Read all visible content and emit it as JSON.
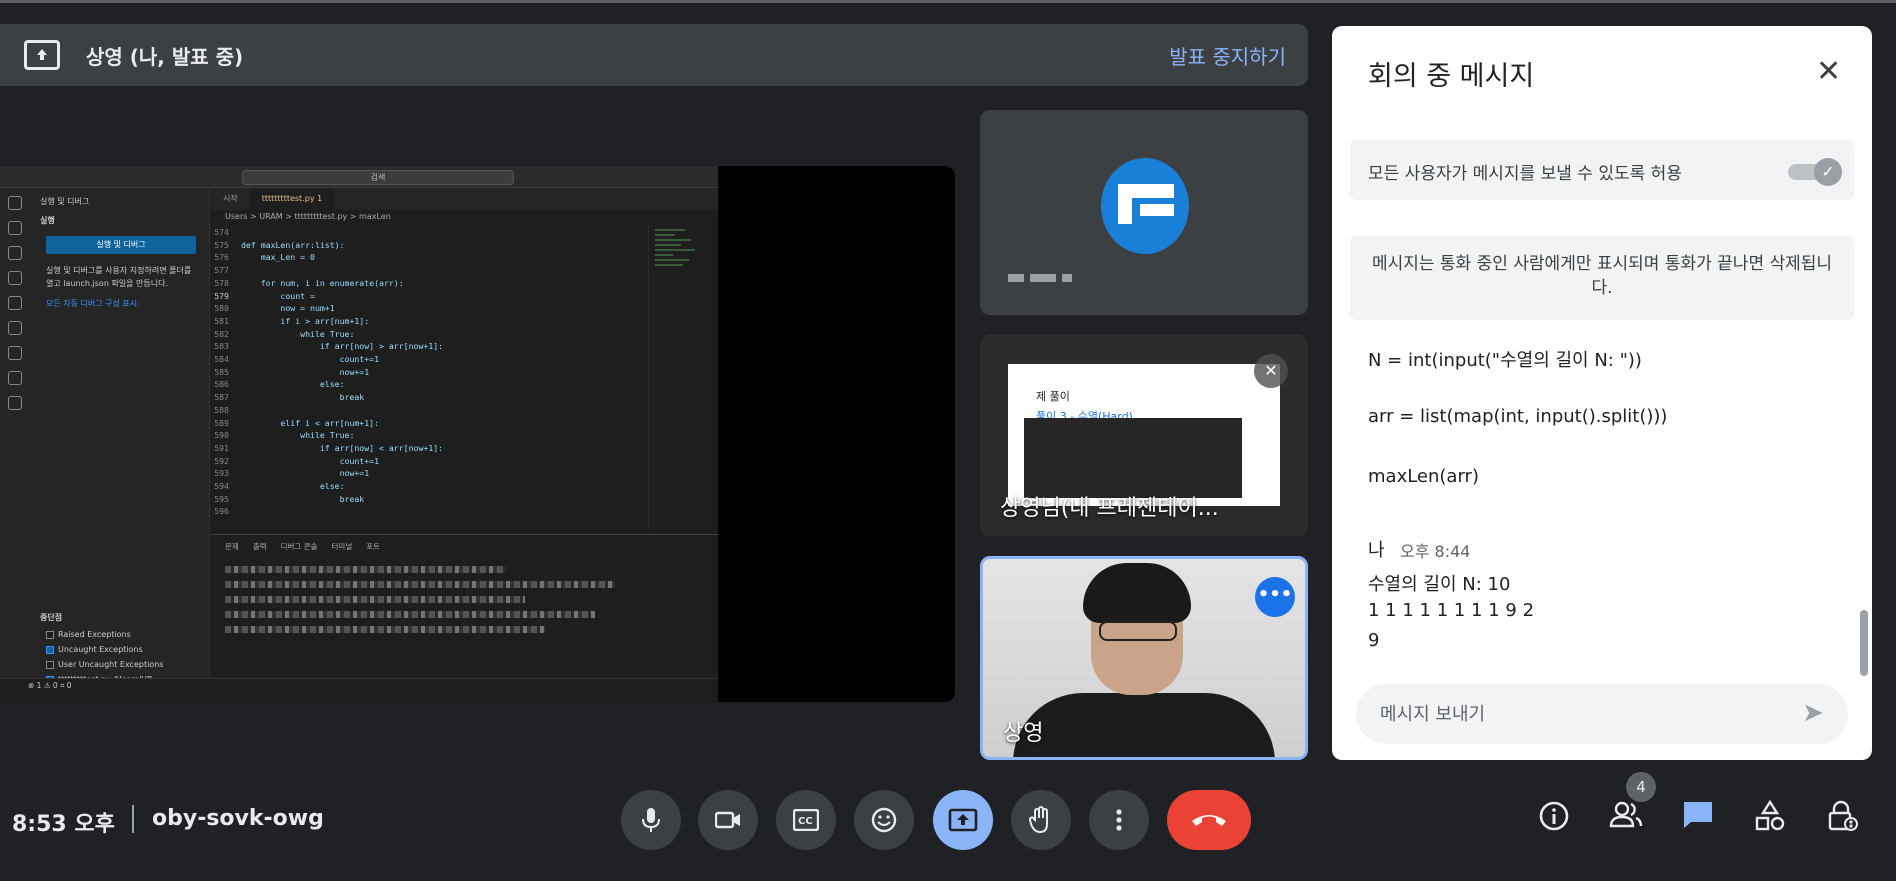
{
  "present_bar": {
    "title": "상영 (나, 발표 중)",
    "stop_label": "발표 중지하기"
  },
  "vscode": {
    "search": "검색",
    "sidebar_header": "실행 및 디버그",
    "sidebar_section": "실행",
    "run_button": "실행 및 디버그",
    "help_text": "실행 및 디버그를 사용자 지정하려면 폴더를 열고 launch.json 파일을 만듭니다.",
    "show_all_link": "모든 자동 디버그 구성 표시.",
    "breakpoints_header": "중단점",
    "breakpoints": [
      {
        "label": "Raised Exceptions",
        "checked": false
      },
      {
        "label": "Uncaught Exceptions",
        "checked": true
      },
      {
        "label": "User Uncaught Exceptions",
        "checked": false
      },
      {
        "label": "tttttttttest.py  /Users/UR...",
        "checked": true
      }
    ],
    "tabs": [
      "시작",
      "tttttttttest.py 1"
    ],
    "breadcrumb": "Users > URAM > tttttttttest.py > maxLen",
    "code": [
      {
        "ln": "574",
        "text": ""
      },
      {
        "ln": "575",
        "text": "def maxLen(arr:list):"
      },
      {
        "ln": "576",
        "text": "    max_Len = 0"
      },
      {
        "ln": "577",
        "text": ""
      },
      {
        "ln": "578",
        "text": "    for num, i in enumerate(arr):"
      },
      {
        "ln": "579",
        "text": "        count = "
      },
      {
        "ln": "580",
        "text": "        now = num+1"
      },
      {
        "ln": "581",
        "text": "        if i > arr[num+1]:"
      },
      {
        "ln": "582",
        "text": "            while True:"
      },
      {
        "ln": "583",
        "text": "                if arr[now] > arr[now+1]:"
      },
      {
        "ln": "584",
        "text": "                    count+=1"
      },
      {
        "ln": "585",
        "text": "                    now+=1"
      },
      {
        "ln": "586",
        "text": "                else:"
      },
      {
        "ln": "587",
        "text": "                    break"
      },
      {
        "ln": "588",
        "text": ""
      },
      {
        "ln": "589",
        "text": "        elif i < arr[num+1]:"
      },
      {
        "ln": "590",
        "text": "            while True:"
      },
      {
        "ln": "591",
        "text": "                if arr[now] < arr[now+1]:"
      },
      {
        "ln": "592",
        "text": "                    count+=1"
      },
      {
        "ln": "593",
        "text": "                    now+=1"
      },
      {
        "ln": "594",
        "text": "                else:"
      },
      {
        "ln": "595",
        "text": "                    break"
      },
      {
        "ln": "596",
        "text": ""
      }
    ],
    "panel_tabs": [
      "문제",
      "출력",
      "디버그 콘솔",
      "터미널",
      "포트"
    ],
    "status": "⊗ 1 ⚠ 0   ⌗ 0"
  },
  "tiles": {
    "presentation_label": "상영님(내 프레젠테이...",
    "slide_line1": "제 풀이",
    "slide_line2": "풀이 3 - 수열(Hard)",
    "self_name": "상영"
  },
  "chat": {
    "title": "회의 중 메시지",
    "allow_label": "모든 사용자가 메시지를 보낼 수 있도록 허용",
    "info": "메시지는 통화 중인 사람에게만 표시되며 통화가 끝나면 삭제됩니다.",
    "messages": [
      "N = int(input(\"수열의 길이 N: \"))",
      "arr = list(map(int, input().split()))",
      "maxLen(arr)"
    ],
    "sender": "나",
    "time": "오후 8:44",
    "last_message": [
      "수열의 길이 N: 10",
      "1 1 1 1 1 1 1 1 9 2",
      "9"
    ],
    "compose_placeholder": "메시지 보내기"
  },
  "bottom": {
    "clock": "8:53 오후",
    "meeting_code": "oby-sovk-owg",
    "people_count": "4"
  },
  "colors": {
    "background": "#202124",
    "accent": "#8ab4f8",
    "hangup": "#ea4335"
  }
}
